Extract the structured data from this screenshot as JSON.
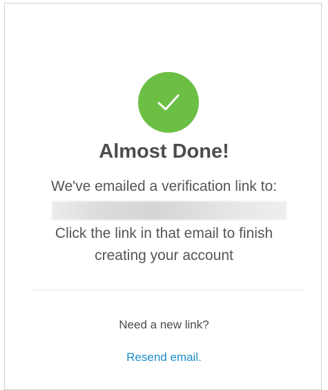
{
  "status_icon": {
    "name": "check-icon",
    "color": "#6cbf45"
  },
  "heading": "Almost Done!",
  "message": {
    "intro": "We've emailed a verification link to:",
    "email": "",
    "instructions_line1": "Click the link in that email to finish",
    "instructions_line2": "creating your account"
  },
  "footer": {
    "prompt": "Need a new link?",
    "resend_label": "Resend email.",
    "link_color": "#1a8cc7"
  }
}
